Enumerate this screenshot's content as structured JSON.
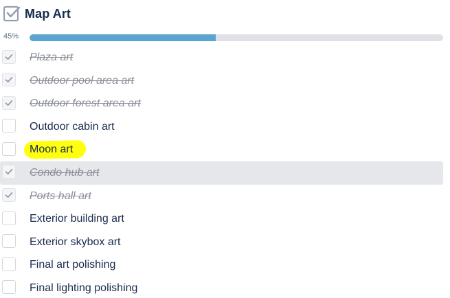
{
  "checklist": {
    "title": "Map Art",
    "progress": {
      "label": "45%",
      "value": 0.45
    },
    "items": [
      {
        "label": "Plaza art",
        "checked": true
      },
      {
        "label": "Outdoor pool area art",
        "checked": true
      },
      {
        "label": "Outdoor forest area art",
        "checked": true
      },
      {
        "label": "Outdoor cabin art",
        "checked": false
      },
      {
        "label": "Moon art",
        "checked": false,
        "highlighted": true
      },
      {
        "label": "Condo hub art",
        "checked": true,
        "hovered": true
      },
      {
        "label": "Ports hall art",
        "checked": true
      },
      {
        "label": "Exterior building art",
        "checked": false
      },
      {
        "label": "Exterior skybox art",
        "checked": false
      },
      {
        "label": "Final art polishing",
        "checked": false
      },
      {
        "label": "Final lighting polishing",
        "checked": false
      }
    ]
  },
  "colors": {
    "progress_fill": "#5ba4cf",
    "progress_track": "#dfe1e6",
    "highlight": "#ffff00",
    "hover_row": "#e6e7ea",
    "done_text": "#8a8f98",
    "text": "#172b4d"
  },
  "icons": {
    "header": "checklist-checkbox-icon",
    "item_checked": "checkmark-icon"
  }
}
